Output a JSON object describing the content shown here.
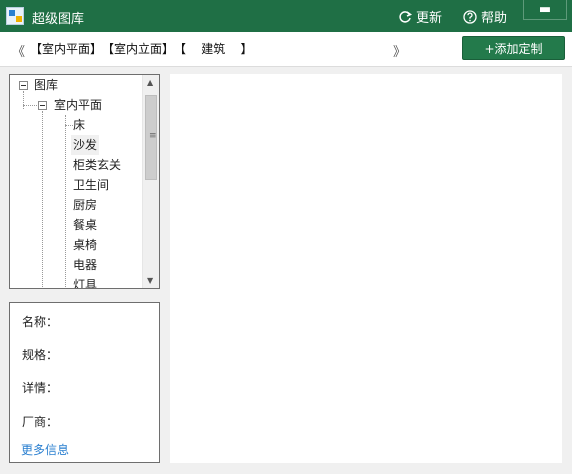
{
  "window": {
    "title": "超级图库",
    "refresh_label": "更新",
    "help_label": "帮助",
    "close_glyph": "▬"
  },
  "nav": {
    "prev_glyph": "《",
    "next_glyph": "》",
    "crumbs": [
      "【室内平面】",
      "【室内立面】",
      "【    建筑    】"
    ],
    "add_button": "+添加定制"
  },
  "tree": {
    "root": "图库",
    "child": "室内平面",
    "items": [
      "床",
      "沙发",
      "柜类玄关",
      "卫生间",
      "厨房",
      "餐桌",
      "桌椅",
      "电器",
      "灯具"
    ],
    "selected_index": 1
  },
  "info": {
    "name_label": "名称：",
    "spec_label": "规格：",
    "detail_label": "详情：",
    "maker_label": "厂商：",
    "more_link": "更多信息"
  },
  "colors": {
    "titlebar": "#1f6f45",
    "button": "#237a4b",
    "link": "#2a7fd0"
  }
}
